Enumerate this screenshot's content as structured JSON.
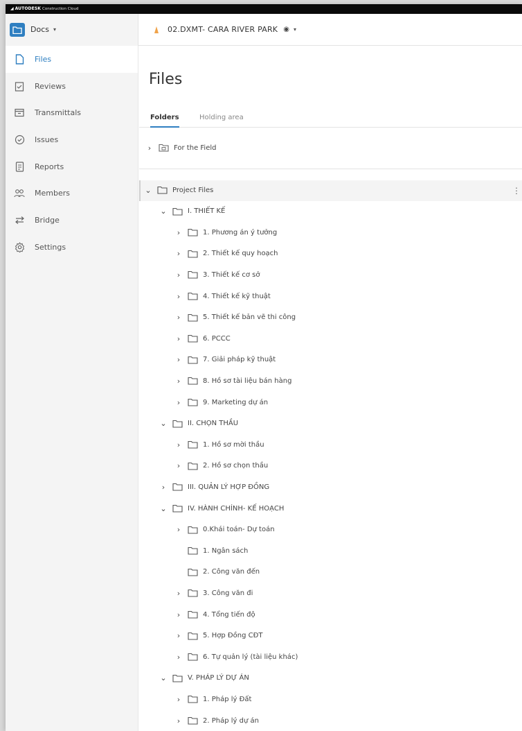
{
  "brand": {
    "name": "AUTODESK",
    "product": "Construction Cloud"
  },
  "topbar": {
    "module_label": "Docs",
    "project_name": "02.DXMT- CARA RIVER PARK"
  },
  "sidebar": {
    "items": [
      {
        "label": "Files",
        "icon": "file-icon"
      },
      {
        "label": "Reviews",
        "icon": "reviews-icon"
      },
      {
        "label": "Transmittals",
        "icon": "transmittals-icon"
      },
      {
        "label": "Issues",
        "icon": "issues-icon"
      },
      {
        "label": "Reports",
        "icon": "reports-icon"
      },
      {
        "label": "Members",
        "icon": "members-icon"
      },
      {
        "label": "Bridge",
        "icon": "bridge-icon"
      },
      {
        "label": "Settings",
        "icon": "settings-icon"
      }
    ]
  },
  "main": {
    "title": "Files",
    "tabs": [
      {
        "label": "Folders"
      },
      {
        "label": "Holding area"
      }
    ],
    "field_folder": "For the Field",
    "tree": [
      "Project Files",
      "I. THIẾT KẾ",
      "1. Phương án ý tưởng",
      "2. Thiết kế quy hoạch",
      "3. Thiết kế cơ sở",
      "4. Thiết kế kỹ thuật",
      "5. Thiết kế bản vẽ thi công",
      "6. PCCC",
      "7. Giải pháp kỹ thuật",
      "8. Hồ sơ tài liệu bán hàng",
      "9. Marketing dự án",
      "II. CHỌN THẦU",
      "1. Hồ sơ mời thầu",
      "2. Hồ sơ chọn thầu",
      "III. QUẢN LÝ HỢP ĐỒNG",
      "IV. HÀNH CHÍNH- KẾ HOẠCH",
      "0.Khái toán- Dự toán",
      "1. Ngân sách",
      "2. Công văn đến",
      "3. Công văn đi",
      "4. Tổng tiến độ",
      "5. Hợp Đồng CĐT",
      "6. Tự quản lý (tài liệu khác)",
      "V. PHÁP LÝ DỰ ÁN",
      "1. Pháp lý Đất",
      "2. Pháp lý dự án"
    ]
  },
  "colors": {
    "accent": "#2f7fc1",
    "sidebar_bg": "#f4f4f4",
    "brandbar_bg": "#0a0a0a"
  }
}
